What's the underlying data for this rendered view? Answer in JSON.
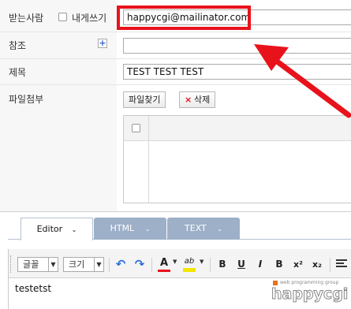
{
  "form": {
    "to_label": "받는사람",
    "to_self_label": "내게쓰기",
    "to_value": "happycgi@mailinator.com",
    "cc_label": "참조",
    "cc_value": "",
    "subject_label": "제목",
    "subject_value": "TEST TEST TEST",
    "attach_label": "파일첨부",
    "find_file_label": "파일찾기",
    "delete_label": "삭제"
  },
  "editor": {
    "tabs": [
      {
        "label": "Editor",
        "active": true
      },
      {
        "label": "HTML",
        "active": false
      },
      {
        "label": "TEXT",
        "active": false
      }
    ],
    "toolbar": {
      "font_label": "글꼴",
      "size_label": "크기",
      "bold": "B",
      "underline": "U",
      "italic": "I",
      "strike": "B",
      "superscript": "x²",
      "subscript": "x₂"
    },
    "content": "testetst"
  },
  "watermark": {
    "small": "web programming group",
    "brand": "happycgi"
  },
  "colors": {
    "highlight_box": "#e8121b",
    "arrow": "#e8121b",
    "font_color_bar": "#e8121b",
    "highlight_color_bar": "#f2e600",
    "tab_inactive": "#9db0c8"
  }
}
